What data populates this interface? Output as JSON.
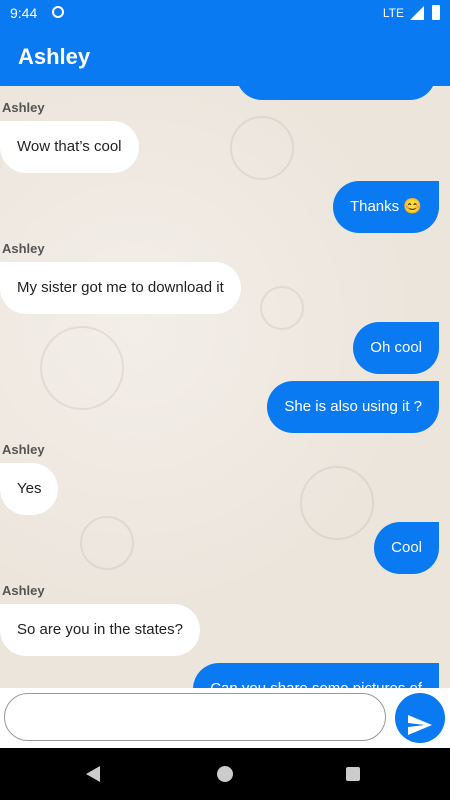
{
  "status_bar": {
    "time": "9:44",
    "network": "LTE",
    "icons": [
      "app-notification-icon",
      "signal-icon",
      "battery-icon"
    ]
  },
  "app_bar": {
    "title": "Ashley"
  },
  "messages": [
    {
      "direction": "outgoing",
      "text": ""
    },
    {
      "direction": "incoming",
      "sender": "Ashley",
      "text": "Wow that’s cool"
    },
    {
      "direction": "outgoing",
      "text": "Thanks 😊"
    },
    {
      "direction": "incoming",
      "sender": "Ashley",
      "text": "My sister got me to download it"
    },
    {
      "direction": "outgoing",
      "text": "Oh cool"
    },
    {
      "direction": "outgoing",
      "text": "She is also using it ?"
    },
    {
      "direction": "incoming",
      "sender": "Ashley",
      "text": "Yes"
    },
    {
      "direction": "outgoing",
      "text": "Cool"
    },
    {
      "direction": "incoming",
      "sender": "Ashley",
      "text": "So are you in the states?"
    },
    {
      "direction": "outgoing",
      "text": "Can you share some pictures of"
    }
  ],
  "composer": {
    "placeholder": "",
    "value": "",
    "send_icon": "send-icon"
  },
  "nav_bar": {
    "icons": [
      "back-icon",
      "home-icon",
      "recents-icon"
    ]
  },
  "colors": {
    "accent": "#0a7af2",
    "incoming_bubble": "#ffffff",
    "chat_background": "#ece5dc"
  }
}
